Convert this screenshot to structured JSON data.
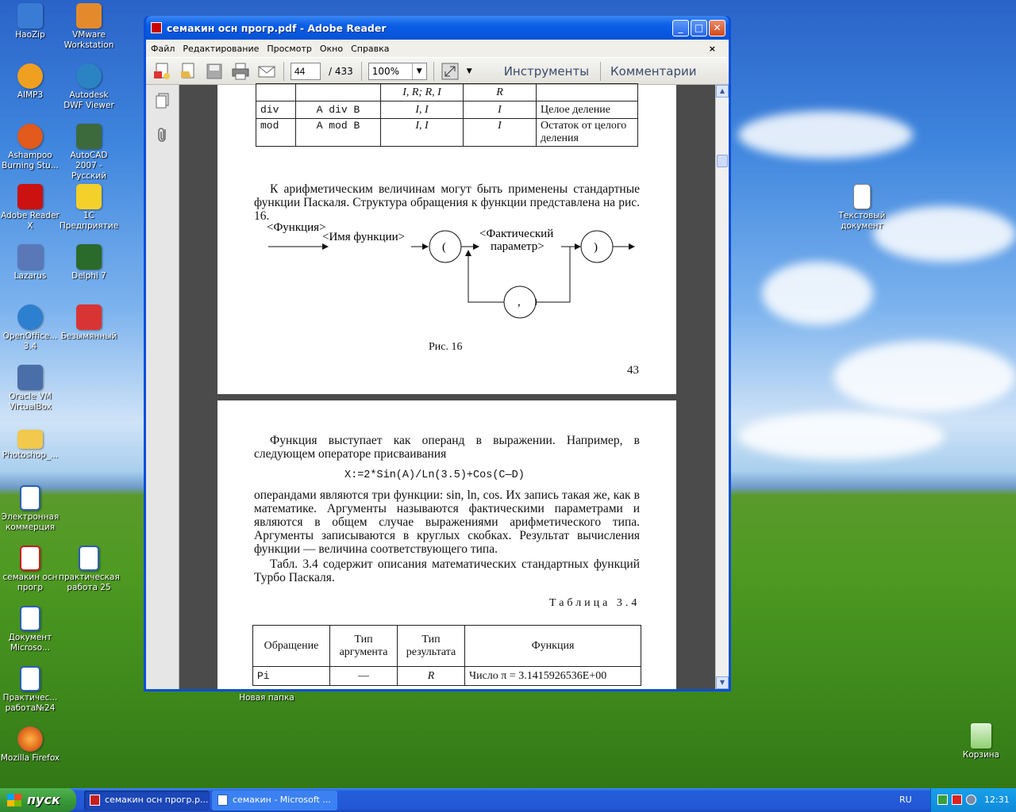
{
  "desktop": {
    "icons": [
      {
        "label": "HaoZip",
        "color": "#3a7bd5",
        "glyph": "Z"
      },
      {
        "label": "VMware Workstation",
        "color": "#e38b2c",
        "glyph": "▣"
      },
      {
        "label": "AIMP3",
        "color": "#f0a020",
        "glyph": "▲"
      },
      {
        "label": "Autodesk DWF Viewer",
        "color": "#2b83c4",
        "glyph": "◎"
      },
      {
        "label": "Ashampoo Burning Stu...",
        "color": "#e25a1c",
        "glyph": "6"
      },
      {
        "label": "AutoCAD 2007 - Русский",
        "color": "#3c6a3c",
        "glyph": "A"
      },
      {
        "label": "Adobe Reader X",
        "color": "#cc1111",
        "glyph": "A"
      },
      {
        "label": "1С Предприятие",
        "color": "#f4d02a",
        "glyph": "1С"
      },
      {
        "label": "Lazarus",
        "color": "#5a78b8",
        "glyph": "★"
      },
      {
        "label": "Delphi 7",
        "color": "#2a6a2a",
        "glyph": "7"
      },
      {
        "label": "OpenOffice... 3.4",
        "color": "#2d7fd0",
        "glyph": "☁"
      },
      {
        "label": "Безымянный",
        "color": "#d93434",
        "glyph": "✎"
      },
      {
        "label": "Oracle VM VirtualBox",
        "color": "#4a6fa8",
        "glyph": "▦"
      },
      {
        "label": "Photoshop_...",
        "color": "#f2c94c",
        "glyph": "▭"
      },
      {
        "label": "Электронная коммерция",
        "color": "#2b5fb8",
        "glyph": "W"
      },
      {
        "label": "семакин осн прогр",
        "color": "#c81e1e",
        "glyph": "PDF"
      },
      {
        "label": "практическая работа 25",
        "color": "#2b5fb8",
        "glyph": "W"
      },
      {
        "label": "Документ Microso...",
        "color": "#2b5fb8",
        "glyph": "W"
      },
      {
        "label": "Практичес... работа№24",
        "color": "#2b5fb8",
        "glyph": "W"
      },
      {
        "label": "Mozilla Firefox",
        "color": "#e0681a",
        "glyph": "◉"
      },
      {
        "label": "Новая папка",
        "color": "#f2c94c",
        "glyph": "▭"
      },
      {
        "label": "Текстовый документ",
        "color": "#f6f6f6",
        "glyph": "≡"
      },
      {
        "label": "Корзина",
        "color": "#8fd06f",
        "glyph": "♻"
      }
    ]
  },
  "window": {
    "title": "семакин осн прогр.pdf - Adobe Reader",
    "menu": [
      "Файл",
      "Редактирование",
      "Просмотр",
      "Окно",
      "Справка"
    ],
    "page_current": "44",
    "page_total": "/ 433",
    "zoom": "100%",
    "tools_label": "Инструменты",
    "comments_label": "Комментарии"
  },
  "page1": {
    "table_rows": [
      {
        "op": "",
        "example": "",
        "args": "I, R; R, I",
        "result": "R",
        "func": ""
      },
      {
        "op": "div",
        "example": "A div B",
        "args": "I, I",
        "result": "I",
        "func": "Целое деление"
      },
      {
        "op": "mod",
        "example": "A mod B",
        "args": "I, I",
        "result": "I",
        "func": "Остаток от целого деления"
      }
    ],
    "paragraph": "К арифметическим величинам могут быть применены стандартные функции Паскаля. Структура обращения к функции представлена на рис. 16.",
    "diagram": {
      "func": "<Функция>",
      "name": "<Имя функции>",
      "open": "(",
      "param1": "<Фактический",
      "param2": "параметр>",
      "close": ")",
      "comma": ","
    },
    "caption": "Рис. 16",
    "page_number": "43"
  },
  "page2": {
    "para1": "Функция выступает как операнд в выражении. Например, в следующем операторе присваивания",
    "code": "X:=2*Sin(A)/Ln(3.5)+Cos(C—D)",
    "para2": "операндами являются три функции: sin, ln, cos. Их запись такая же, как в математике. Аргументы называются фактическими параметрами и являются в общем случае выражениями арифметического типа. Аргументы записываются в круглых скобках. Результат вычисления функции — величина соответствующего типа.",
    "para3": "Табл. 3.4 содержит описания математических стандартных функций Турбо Паскаля.",
    "table_title": "Таблица 3.4",
    "headers": [
      "Обращение",
      "Тип аргумента",
      "Тип результата",
      "Функция"
    ],
    "rows": [
      {
        "call": "Pi",
        "arg": "—",
        "result": "R",
        "func": "Число π = 3.1415926536E+00"
      }
    ]
  },
  "taskbar": {
    "start": "пуск",
    "tasks": [
      "семакин осн прогр.р...",
      "семакин - Microsoft ..."
    ],
    "lang": "RU",
    "time": "12:31"
  }
}
